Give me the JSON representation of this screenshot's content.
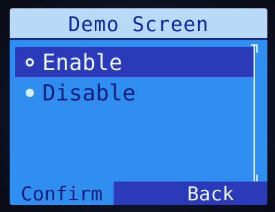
{
  "header": {
    "title": "Demo Screen"
  },
  "menu": {
    "items": [
      {
        "label": "Enable",
        "selected": true
      },
      {
        "label": "Disable",
        "selected": false
      }
    ]
  },
  "softkeys": {
    "left_label": "Confirm",
    "right_label": "Back"
  },
  "colors": {
    "screen_bg": "#2f8ef0",
    "title_bg": "#b9daf6",
    "highlight": "#2a3ab8",
    "dark_text": "#0d1d7a",
    "light_text": "#e8f4ff"
  },
  "icons": {
    "selected_radio": "radio-empty-icon",
    "unselected_radio": "radio-filled-icon"
  }
}
